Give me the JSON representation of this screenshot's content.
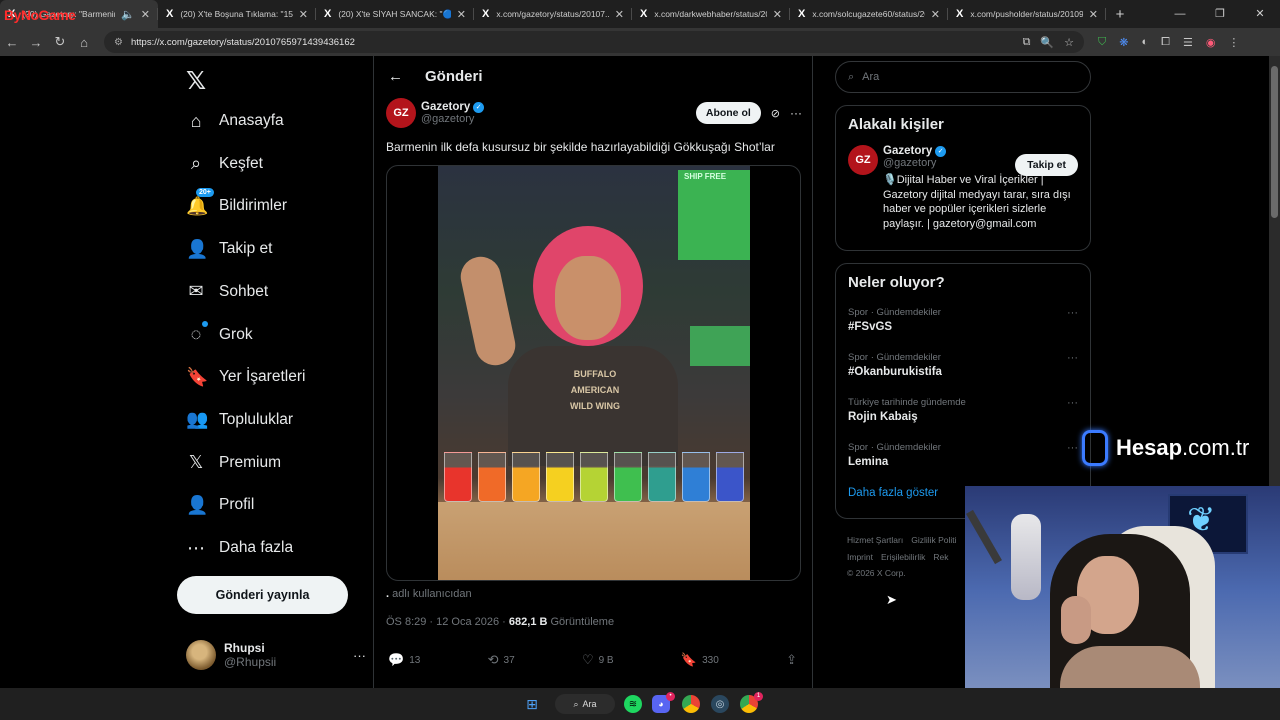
{
  "browser": {
    "tabs": [
      {
        "icon": "X",
        "title": "(20) Gazetory: \"Barmenin...",
        "muted_icon": "🔈",
        "close": "✕"
      },
      {
        "icon": "X",
        "title": "(20) X'te Boşuna Tıklama: \"15 y...",
        "close": "✕"
      },
      {
        "icon": "X",
        "title": "(20) X'te SİYAH SANCAK: \"🔵 E...",
        "close": "✕"
      },
      {
        "icon": "X",
        "title": "x.com/gazetory/status/20107...",
        "close": "✕"
      },
      {
        "icon": "X",
        "title": "x.com/darkwebhaber/status/20...",
        "close": "✕"
      },
      {
        "icon": "X",
        "title": "x.com/solcugazete60/status/20...",
        "close": "✕"
      },
      {
        "icon": "X",
        "title": "x.com/pusholder/status/20109...",
        "close": "✕"
      }
    ],
    "new_tab": "+",
    "window_controls": [
      "—",
      "❐",
      "✕"
    ],
    "url": "https://x.com/gazetory/status/2010765971439436162",
    "nav_icons": [
      "←",
      "→",
      "↻",
      "⌂"
    ],
    "omnibox_icons": [
      "⧉",
      "🔍",
      "☆"
    ],
    "extension_icons": [
      "⛉",
      "❋",
      "◐",
      "⧠",
      "☰",
      "◉",
      "⋮"
    ]
  },
  "watermark": "ByNoGame",
  "x": {
    "logo": "𝕏",
    "nav": [
      {
        "icon": "⌂",
        "label": "Anasayfa"
      },
      {
        "icon": "⌕",
        "label": "Keşfet"
      },
      {
        "icon": "🔔",
        "label": "Bildirimler",
        "badge": "20+"
      },
      {
        "icon": "👤",
        "label": "Takip et"
      },
      {
        "icon": "✉",
        "label": "Sohbet"
      },
      {
        "icon": "◌",
        "label": "Grok"
      },
      {
        "icon": "🔖",
        "label": "Yer İşaretleri"
      },
      {
        "icon": "👥",
        "label": "Topluluklar"
      },
      {
        "icon": "𝕏",
        "label": "Premium"
      },
      {
        "icon": "👤",
        "label": "Profil"
      },
      {
        "icon": "⋯",
        "label": "Daha fazla"
      }
    ],
    "post_button": "Gönderi yayınla",
    "me": {
      "name": "Rhupsi",
      "handle": "@Rhupsii",
      "more": "···"
    },
    "header": {
      "back": "←",
      "title": "Gönderi"
    },
    "post": {
      "avatar_text": "GZ",
      "author": "Gazetory",
      "handle": "@gazetory",
      "subscribe": "Abone ol",
      "text": "Barmenin ilk defa kusursuz bir şekilde hazırlayabildiği Gökkuşağı Shot’lar",
      "via_prefix": ".",
      "via_suffix": " adlı kullanıcıdan",
      "time": "ÖS 8:29 · 12 Oca 2026 · ",
      "views_count": "682,1 B",
      "views_label": " Görüntüleme",
      "video_sign": "SHIP FREE",
      "shirt_text": "BUFFALO\nAMERICAN\nWILD WING",
      "shot_colors": [
        "#e8342c",
        "#f06a28",
        "#f5a623",
        "#f5d020",
        "#b5d334",
        "#3fbf4f",
        "#2f9e8f",
        "#2f7fd6",
        "#3b55c9"
      ],
      "actions": [
        {
          "icon": "💬",
          "count": "13"
        },
        {
          "icon": "⟲",
          "count": "37"
        },
        {
          "icon": "♡",
          "count": "9 B"
        },
        {
          "icon": "🔖",
          "count": "330"
        },
        {
          "icon": "⇪",
          "count": ""
        }
      ]
    },
    "right": {
      "search_placeholder": "Ara",
      "related_title": "Alakalı kişiler",
      "related": {
        "name": "Gazetory",
        "handle": "@gazetory",
        "follow": "Takip et",
        "bio": "🎙️Dijital Haber ve Viral İçerikler | Gazetory dijital medyayı tarar, sıra dışı haber ve popüler içerikleri sizlerle paylaşır. | gazetory@gmail.com"
      },
      "trends_title": "Neler oluyor?",
      "trends": [
        {
          "category": "Spor · Gündemdekiler",
          "tag": "#FSvGS"
        },
        {
          "category": "Spor · Gündemdekiler",
          "tag": "#Okanburukistifa"
        },
        {
          "category": "Türkiye tarihinde gündemde",
          "tag": "Rojin Kabaiş"
        },
        {
          "category": "Spor · Gündemdekiler",
          "tag": "Lemina"
        }
      ],
      "show_more": "Daha fazla göster",
      "footer": [
        "Hizmet Şartları",
        "Gizlilik Politi",
        "Imprint",
        "Erişilebilirlik",
        "Rek",
        "© 2026 X Corp."
      ]
    }
  },
  "overlay": {
    "brand": "Hesap",
    "brand_suffix": ".com.tr"
  },
  "taskbar": {
    "search_label": "Ara",
    "icons": [
      "windows-start",
      "spotify",
      "discord",
      "chrome",
      "steam",
      "chrome-profile"
    ]
  },
  "colors": {
    "accent": "#1d9bf0",
    "background": "#000000",
    "border": "#2f3336",
    "muted": "#71767b"
  }
}
